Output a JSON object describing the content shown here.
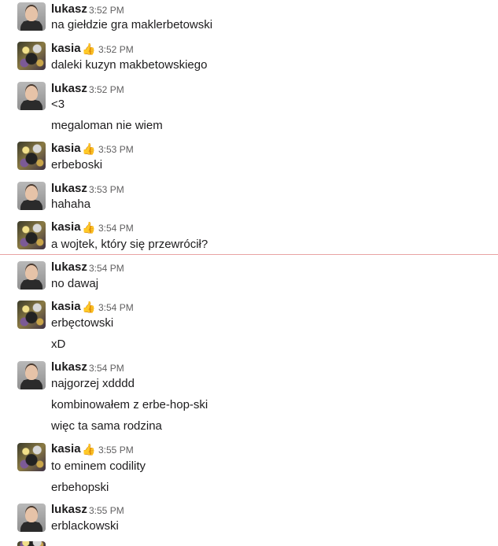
{
  "messages": [
    {
      "user": "lukasz",
      "time": "3:52 PM",
      "texts": [
        "na giełdzie gra maklerbetowski"
      ]
    },
    {
      "user": "kasia",
      "emoji": "👍",
      "time": "3:52 PM",
      "texts": [
        "daleki kuzyn makbetowskiego"
      ]
    },
    {
      "user": "lukasz",
      "time": "3:52 PM",
      "texts": [
        "<3",
        "megaloman nie wiem"
      ]
    },
    {
      "user": "kasia",
      "emoji": "👍",
      "time": "3:53 PM",
      "texts": [
        "erbeboski"
      ]
    },
    {
      "user": "lukasz",
      "time": "3:53 PM",
      "texts": [
        "hahaha"
      ]
    },
    {
      "user": "kasia",
      "emoji": "👍",
      "time": "3:54 PM",
      "texts": [
        "a wojtek, który się przewrócił?"
      ]
    },
    {
      "user": "lukasz",
      "time": "3:54 PM",
      "texts": [
        "no dawaj"
      ]
    },
    {
      "user": "kasia",
      "emoji": "👍",
      "time": "3:54 PM",
      "texts": [
        "erbęctowski",
        "xD"
      ]
    },
    {
      "user": "lukasz",
      "time": "3:54 PM",
      "texts": [
        "najgorzej xdddd",
        "kombinowałem z erbe-hop-ski",
        "więc ta sama rodzina"
      ]
    },
    {
      "user": "kasia",
      "emoji": "👍",
      "time": "3:55 PM",
      "texts": [
        "to eminem codility",
        "erbehopski"
      ]
    },
    {
      "user": "lukasz",
      "time": "3:55 PM",
      "texts": [
        "erblackowski"
      ]
    }
  ]
}
